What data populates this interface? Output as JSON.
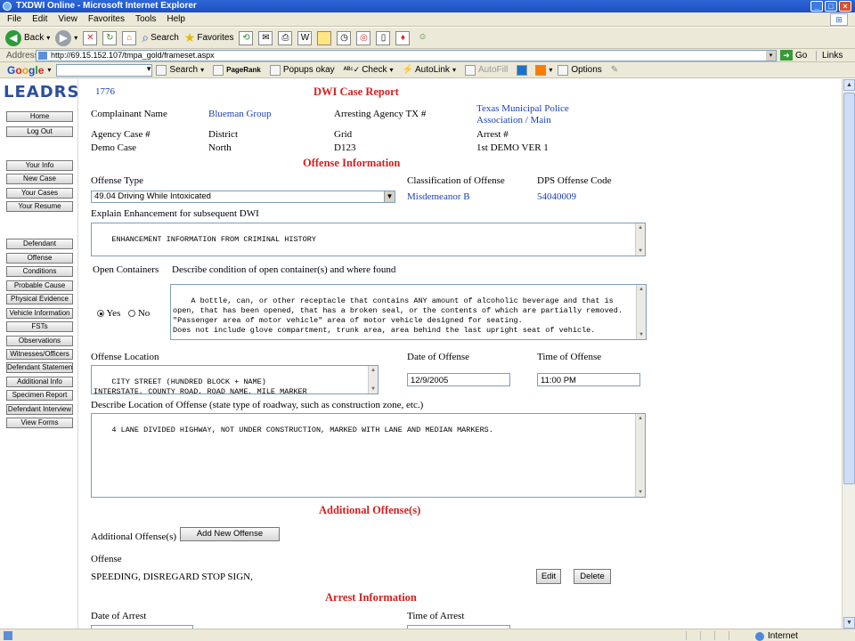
{
  "window": {
    "title": "TXDWI Online - Microsoft Internet Explorer"
  },
  "menu": [
    "File",
    "Edit",
    "View",
    "Favorites",
    "Tools",
    "Help"
  ],
  "toolbar": {
    "back": "Back",
    "search": "Search",
    "favorites": "Favorites"
  },
  "address": {
    "label": "Address",
    "url": "http://69.15.152.107/tmpa_gold/frameset.aspx",
    "go": "Go",
    "links": "Links"
  },
  "googlebar": {
    "search": "Search",
    "pagerank": "PageRank",
    "popups": "Popups okay",
    "check": "Check",
    "autolink": "AutoLink",
    "autofill": "AutoFill",
    "options": "Options"
  },
  "sidebar": {
    "logo": "LEADRS",
    "group1": [
      "Home",
      "Log Out"
    ],
    "group2": [
      "Your Info",
      "New Case",
      "Your Cases",
      "Your Resume"
    ],
    "group3": [
      "Defendant",
      "Offense",
      "Conditions",
      "Probable Cause",
      "Physical Evidence",
      "Vehicle Information",
      "FSTs",
      "Observations",
      "Witnesses/Officers",
      "Defendant Statement",
      "Additional Info",
      "Specimen Report",
      "Defendant Interview",
      "View Forms"
    ]
  },
  "report": {
    "case_number": "1776",
    "title": "DWI Case Report",
    "complainant_label": "Complainant Name",
    "complainant_value": "Blueman Group",
    "arresting_agency_label": "Arresting Agency TX #",
    "arresting_agency_value_line1": "Texas Municipal Police",
    "arresting_agency_value_line2": "Association / Main",
    "agency_case_label": "Agency Case #",
    "district_label": "District",
    "grid_label": "Grid",
    "arrest_label": "Arrest #",
    "agency_case_value": "Demo Case",
    "district_value": "North",
    "grid_value": "D123",
    "arrest_value": "1st DEMO VER 1"
  },
  "offense": {
    "heading": "Offense Information",
    "type_label": "Offense Type",
    "type_value": "49.04 Driving While Intoxicated",
    "classification_label": "Classification of Offense",
    "classification_value": "Misdemeanor B",
    "dps_label": "DPS Offense Code",
    "dps_value": "54040009",
    "enhancement_label": "Explain Enhancement for subsequent DWI",
    "enhancement_value": "ENHANCEMENT INFORMATION FROM CRIMINAL HISTORY",
    "open_containers_label": "Open Containers",
    "describe_container_label": "Describe condition of open container(s) and where found",
    "yes_label": "Yes",
    "no_label": "No",
    "open_containers_selected": "Yes",
    "container_text": "A bottle, can, or other receptacle that contains ANY amount of alcoholic beverage and that is open, that has been opened, that has a broken seal, or the contents of which are partially removed.\n\"Passenger area of motor vehicle\" area of motor vehicle designed for seating.\nDoes not include glove compartment, trunk area, area behind the last upright seat of vehicle.",
    "location_label": "Offense Location",
    "location_value": "CITY STREET (HUNDRED BLOCK + NAME)\nINTERSTATE, COUNTY ROAD, ROAD NAME, MILE MARKER",
    "date_label": "Date of Offense",
    "date_value": "12/9/2005",
    "time_label": "Time of Offense",
    "time_value": "11:00 PM",
    "describe_location_label": "Describe Location of Offense (state type of roadway, such as construction zone, etc.)",
    "describe_location_value": "4 LANE DIVIDED HIGHWAY, NOT UNDER CONSTRUCTION, MARKED WITH LANE AND MEDIAN MARKERS."
  },
  "additional": {
    "heading": "Additional Offense(s)",
    "label": "Additional Offense(s)",
    "add_button": "Add New Offense",
    "offense_label": "Offense",
    "offense_value": "SPEEDING, DISREGARD STOP SIGN,",
    "edit_button": "Edit",
    "delete_button": "Delete"
  },
  "arrest": {
    "heading": "Arrest Information",
    "date_label": "Date of Arrest",
    "time_label": "Time of Arrest"
  },
  "status": {
    "zone": "Internet"
  }
}
